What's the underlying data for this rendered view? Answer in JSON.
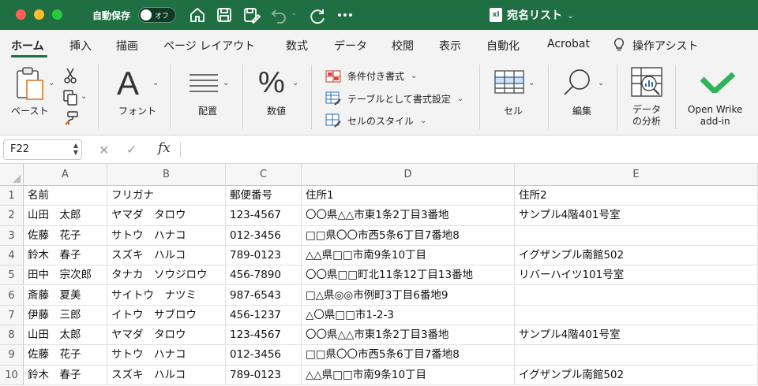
{
  "titlebar": {
    "autosave_label": "自動保存",
    "toggle_label": "オフ",
    "document_title": "宛名リスト",
    "app_badge": "xl",
    "chevron": "⌄",
    "icons": [
      "home-icon",
      "save-icon",
      "save-as-icon",
      "undo-icon",
      "redo-icon",
      "more-icon"
    ]
  },
  "tabs": [
    {
      "label": "ホーム",
      "active": true
    },
    {
      "label": "挿入"
    },
    {
      "label": "描画"
    },
    {
      "label": "ページ レイアウト"
    },
    {
      "label": "数式"
    },
    {
      "label": "データ"
    },
    {
      "label": "校閲"
    },
    {
      "label": "表示"
    },
    {
      "label": "自動化"
    },
    {
      "label": "Acrobat"
    },
    {
      "label": "操作アシスト"
    }
  ],
  "ribbon": {
    "paste": "ペースト",
    "font": "フォント",
    "alignment": "配置",
    "number": "数値",
    "conditional_format": "条件付き書式",
    "format_as_table": "テーブルとして書式設定",
    "cell_styles": "セルのスタイル",
    "cells": "セル",
    "editing": "編集",
    "analyze_line1": "データ",
    "analyze_line2": "の分析",
    "wrike_line1": "Open Wrike",
    "wrike_line2": "add-in",
    "font_glyph": "A",
    "number_glyph": "%"
  },
  "formula_bar": {
    "name_box": "F22",
    "fx": "fx",
    "formula": ""
  },
  "grid": {
    "columns": [
      "A",
      "B",
      "C",
      "D",
      "E"
    ],
    "rows": [
      {
        "n": "1",
        "cells": [
          "名前",
          "フリガナ",
          "郵便番号",
          "住所1",
          "住所2"
        ]
      },
      {
        "n": "2",
        "cells": [
          "山田　太郎",
          "ヤマダ　タロウ",
          "123-4567",
          "〇〇県△△市東1条2丁目3番地",
          "サンプル4階401号室"
        ]
      },
      {
        "n": "3",
        "cells": [
          "佐藤　花子",
          "サトウ　ハナコ",
          "012-3456",
          "□□県〇〇市西5条6丁目7番地8",
          ""
        ]
      },
      {
        "n": "4",
        "cells": [
          "鈴木　春子",
          "スズキ　ハルコ",
          "789-0123",
          "△△県□□市南9条10丁目",
          "イグザンプル南館502"
        ]
      },
      {
        "n": "5",
        "cells": [
          "田中　宗次郎",
          "タナカ　ソウジロウ",
          "456-7890",
          "〇〇県□□町北11条12丁目13番地",
          "リバーハイツ101号室"
        ]
      },
      {
        "n": "6",
        "cells": [
          "斎藤　夏美",
          "サイトウ　ナツミ",
          "987-6543",
          "□△県◎◎市例町3丁目6番地9",
          ""
        ]
      },
      {
        "n": "7",
        "cells": [
          "伊藤　三郎",
          "イトウ　サブロウ",
          "456-1237",
          "△〇県□□市1-2-3",
          ""
        ]
      },
      {
        "n": "8",
        "cells": [
          "山田　太郎",
          "ヤマダ　タロウ",
          "123-4567",
          "〇〇県△△市東1条2丁目3番地",
          "サンプル4階401号室"
        ]
      },
      {
        "n": "9",
        "cells": [
          "佐藤　花子",
          "サトウ　ハナコ",
          "012-3456",
          "□□県〇〇市西5条6丁目7番地8",
          ""
        ]
      },
      {
        "n": "10",
        "cells": [
          "鈴木　春子",
          "スズキ　ハルコ",
          "789-0123",
          "△△県□□市南9条10丁目",
          "イグザンプル南館502"
        ]
      }
    ]
  },
  "colors": {
    "titlebar": "#1f6f43",
    "accent": "#1f6f43",
    "wrike_green": "#2fb45a"
  }
}
